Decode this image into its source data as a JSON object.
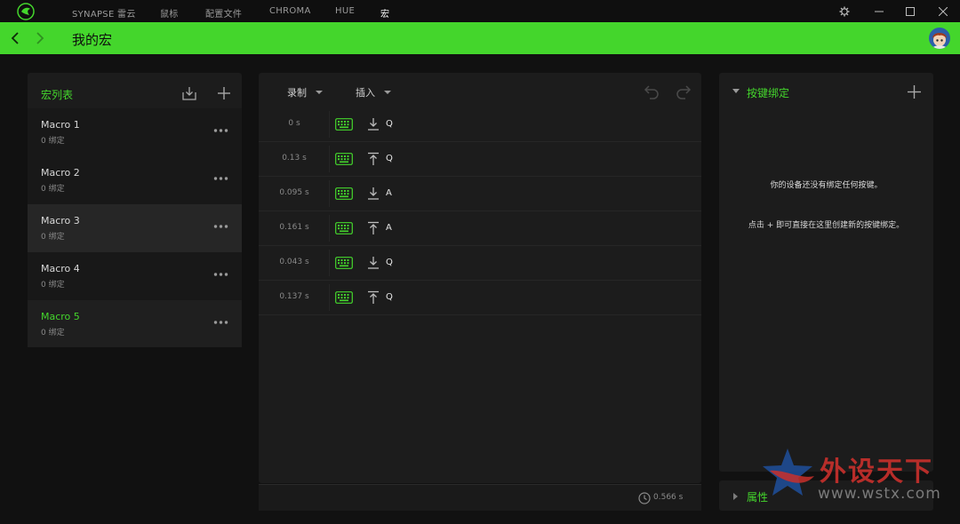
{
  "colors": {
    "accent": "#44d62c",
    "bg": "#111111",
    "panel": "#1c1c1c"
  },
  "topnav": {
    "tabs": [
      "SYNAPSE 雷云",
      "鼠标",
      "配置文件",
      "CHROMA",
      "HUE",
      "宏"
    ],
    "active_tab": "宏",
    "icons": [
      "razer-logo-icon",
      "settings-gear-icon",
      "minimize-icon",
      "maximize-icon",
      "close-icon"
    ]
  },
  "header": {
    "title": "我的宏",
    "icons": [
      "back-arrow-icon",
      "forward-arrow-icon",
      "user-avatar"
    ]
  },
  "macro_list": {
    "title": "宏列表",
    "icons": [
      "import-icon",
      "add-icon"
    ],
    "selected": "Macro 3",
    "active": "Macro 5",
    "items": [
      {
        "name": "Macro 1",
        "bindings": "0 绑定"
      },
      {
        "name": "Macro 2",
        "bindings": "0 绑定"
      },
      {
        "name": "Macro 3",
        "bindings": "0 绑定"
      },
      {
        "name": "Macro 4",
        "bindings": "0 绑定"
      },
      {
        "name": "Macro 5",
        "bindings": "0 绑定"
      }
    ]
  },
  "editor": {
    "record_label": "录制",
    "insert_label": "插入",
    "icons": [
      "undo-icon",
      "redo-icon"
    ],
    "events": [
      {
        "delay": "0 s",
        "action": "key-down",
        "key": "Q"
      },
      {
        "delay": "0.13 s",
        "action": "key-up",
        "key": "Q"
      },
      {
        "delay": "0.095 s",
        "action": "key-down",
        "key": "A"
      },
      {
        "delay": "0.161 s",
        "action": "key-up",
        "key": "A"
      },
      {
        "delay": "0.043 s",
        "action": "key-down",
        "key": "Q"
      },
      {
        "delay": "0.137 s",
        "action": "key-up",
        "key": "Q"
      }
    ],
    "total_time": "0.566 s"
  },
  "bindings_panel": {
    "title": "按键绑定",
    "message_1": "你的设备还没有绑定任何按键。",
    "message_2": "点击 + 即可直接在这里创建新的按键绑定。"
  },
  "properties_panel": {
    "title": "属性"
  },
  "watermark": {
    "text": "外设天下",
    "url": "www.wstx.com"
  }
}
